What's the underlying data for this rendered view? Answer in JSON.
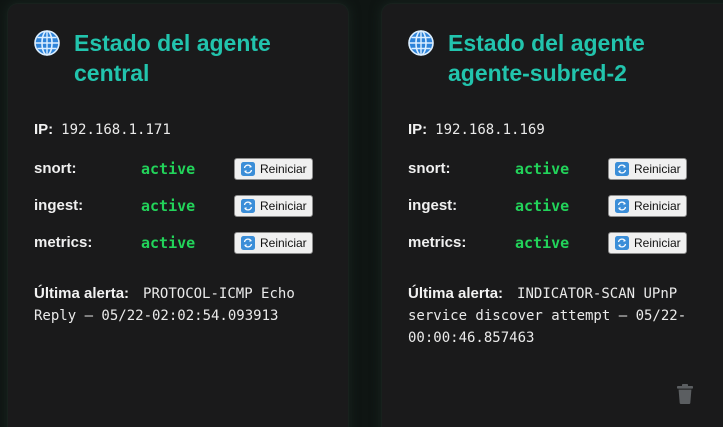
{
  "cards": [
    {
      "title_prefix": "Estado del agente",
      "agent_name": "central",
      "ip_label": "IP:",
      "ip": "192.168.1.171",
      "services": [
        {
          "name": "snort:",
          "status": "active",
          "button": "Reiniciar"
        },
        {
          "name": "ingest:",
          "status": "active",
          "button": "Reiniciar"
        },
        {
          "name": "metrics:",
          "status": "active",
          "button": "Reiniciar"
        }
      ],
      "alert_label": "Última alerta:",
      "alert_text": "PROTOCOL-ICMP Echo Reply — 05/22-02:02:54.093913"
    },
    {
      "title_prefix": "Estado del agente",
      "agent_name": "agente-subred-2",
      "ip_label": "IP:",
      "ip": "192.168.1.169",
      "services": [
        {
          "name": "snort:",
          "status": "active",
          "button": "Reiniciar"
        },
        {
          "name": "ingest:",
          "status": "active",
          "button": "Reiniciar"
        },
        {
          "name": "metrics:",
          "status": "active",
          "button": "Reiniciar"
        }
      ],
      "alert_label": "Última alerta:",
      "alert_text": "INDICATOR-SCAN UPnP service discover attempt — 05/22-00:00:46.857463",
      "has_delete": true
    }
  ],
  "icons": {
    "title": "globe-icon",
    "button": "refresh-icon",
    "delete": "trash-icon"
  },
  "colors": {
    "accent": "#22c4ad",
    "active": "#22d35a",
    "card_bg": "#1a1a1b",
    "page_bg": "#0f1513"
  }
}
